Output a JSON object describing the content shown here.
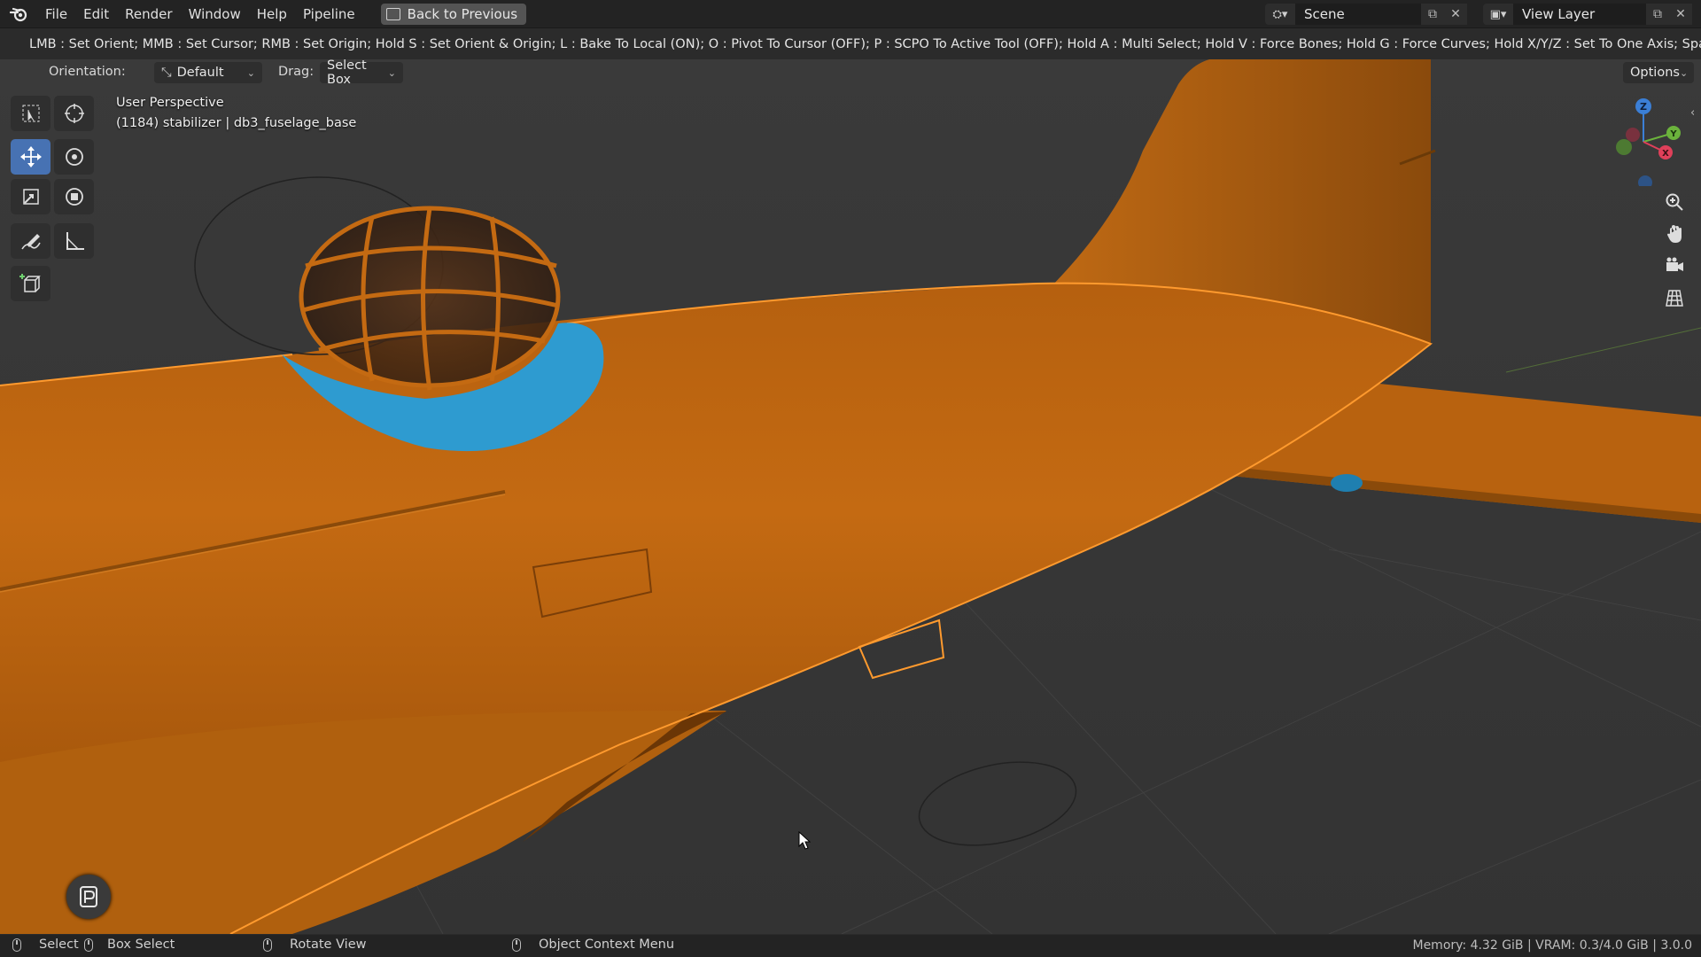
{
  "menu": {
    "items": [
      "File",
      "Edit",
      "Render",
      "Window",
      "Help",
      "Pipeline"
    ],
    "back_button": "Back to Previous"
  },
  "scene": {
    "name": "Scene"
  },
  "view_layer": {
    "name": "View Layer"
  },
  "hints": {
    "text": "LMB : Set Orient;  MMB : Set Cursor;  RMB : Set Origin;  Hold S : Set Orient & Origin;  L : Bake To Local (ON);  O : Pivot To Cursor (OFF);  P : SCPO To Active Tool (OFF); Hold A : Multi Select; Hold V : Force Bones; Hold G : Force Curves; Hold X/Y/Z : Set To One Axis; Space : Force View Rotation; Esc : E"
  },
  "tool_header": {
    "orientation_label": "Orientation:",
    "orientation_value": "Default",
    "drag_label": "Drag:",
    "drag_value": "Select Box",
    "options_label": "Options"
  },
  "viewport": {
    "view_name": "User Perspective",
    "object_info": "(1184) stabilizer | db3_fuselage_base",
    "model_color": "#c46a12",
    "highlight_color": "#2e9bd0",
    "outline_color": "#ff9a2e"
  },
  "toolbar": {
    "tools": [
      "select-box",
      "cursor",
      "move",
      "rotate",
      "scale",
      "transform",
      "annotate",
      "measure",
      "add-cube"
    ],
    "active": "move"
  },
  "gizmo": {
    "x": "X",
    "y": "Y",
    "z": "Z"
  },
  "statusbar": {
    "select": "Select",
    "box_select": "Box Select",
    "rotate_view": "Rotate View",
    "context_menu": "Object Context Menu",
    "stats": "Memory: 4.32 GiB | VRAM: 0.3/4.0 GiB | 3.0.0"
  }
}
